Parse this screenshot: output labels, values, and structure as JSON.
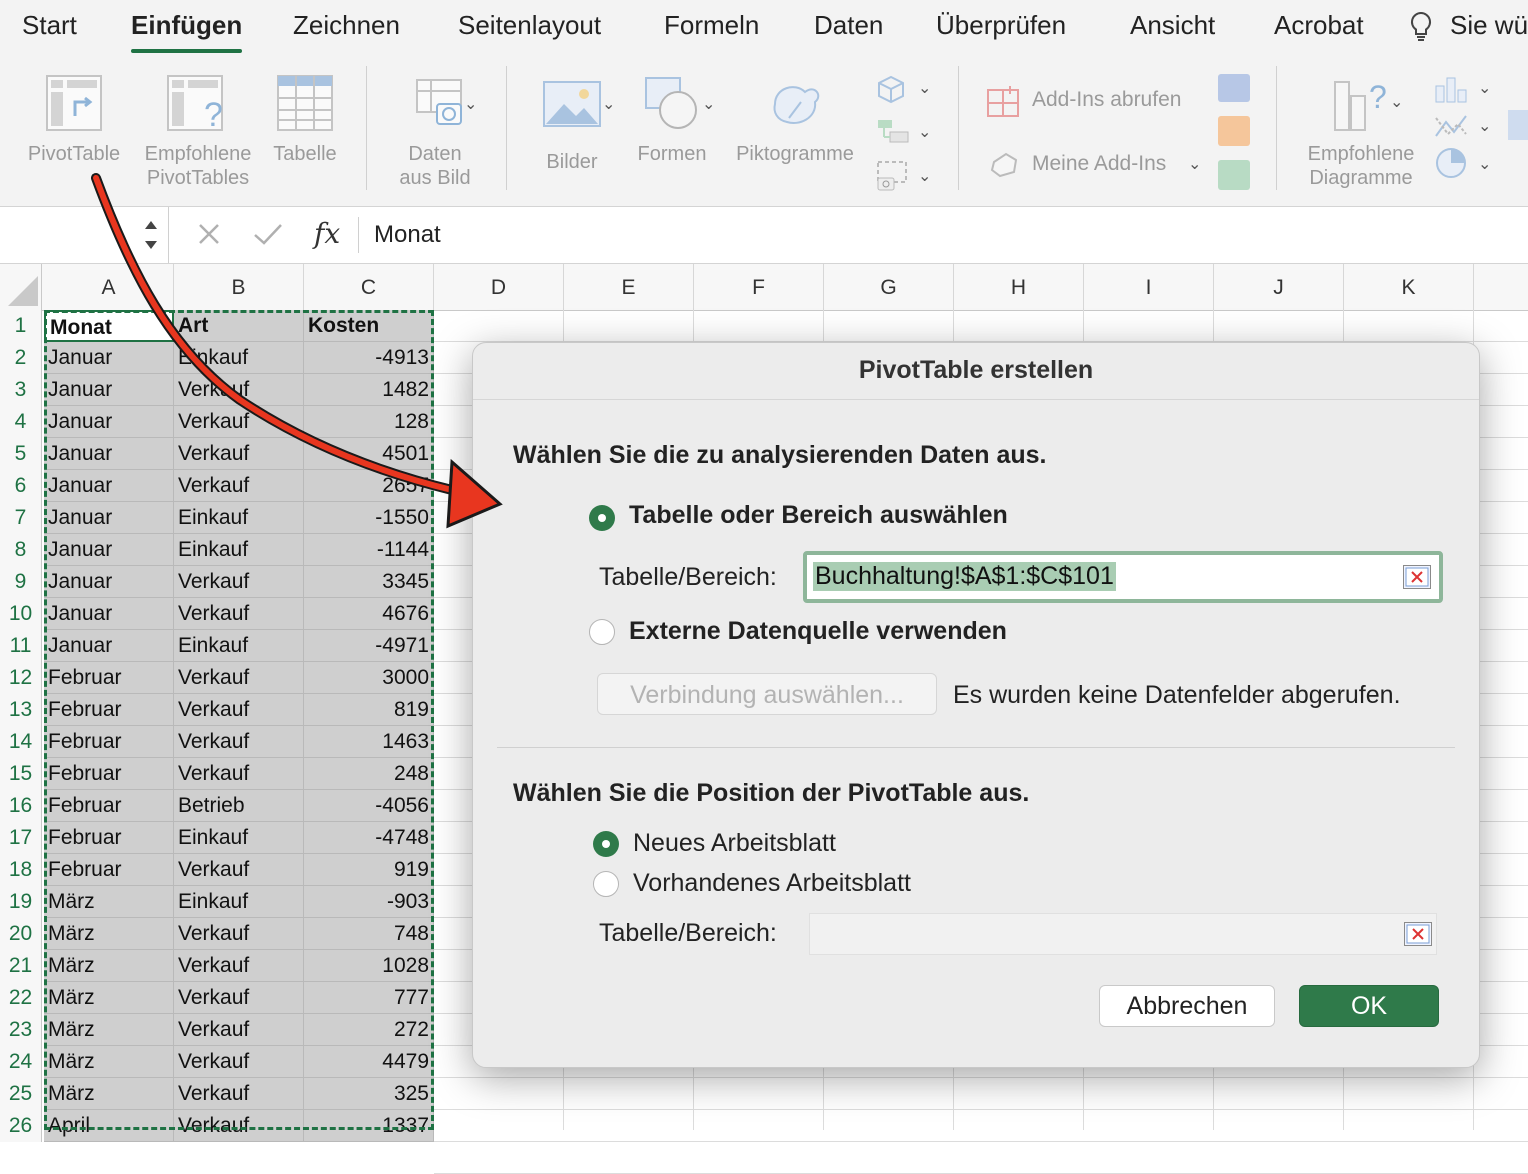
{
  "ribbon": {
    "tabs": [
      "Start",
      "Einfügen",
      "Zeichnen",
      "Seitenlayout",
      "Formeln",
      "Daten",
      "Überprüfen",
      "Ansicht",
      "Acrobat",
      "Sie wü"
    ],
    "active_tab": "Einfügen",
    "tell_me_icon": "lightbulb-icon",
    "buttons": {
      "pivottable": "PivotTable",
      "recommended_line1": "Empfohlene",
      "recommended_line2": "PivotTables",
      "table": "Tabelle",
      "data_from_image_line1": "Daten",
      "data_from_image_line2": "aus Bild",
      "pictures": "Bilder",
      "shapes": "Formen",
      "icons": "Piktogramme",
      "get_addins": "Add-Ins abrufen",
      "my_addins": "Meine Add-Ins",
      "recommended_charts_line1": "Empfohlene",
      "recommended_charts_line2": "Diagramme"
    }
  },
  "formula_bar": {
    "cancel_icon": "close-icon",
    "confirm_icon": "checkmark-icon",
    "fx": "fx",
    "value": "Monat"
  },
  "sheet": {
    "columns": [
      "A",
      "B",
      "C",
      "D",
      "E",
      "F",
      "G",
      "H",
      "I",
      "J",
      "K"
    ],
    "rows": [
      {
        "n": "1",
        "a": "Monat",
        "b": "Art",
        "c": "Kosten"
      },
      {
        "n": "2",
        "a": "Januar",
        "b": "Einkauf",
        "c": "-4913"
      },
      {
        "n": "3",
        "a": "Januar",
        "b": "Verkauf",
        "c": "1482"
      },
      {
        "n": "4",
        "a": "Januar",
        "b": "Verkauf",
        "c": "128"
      },
      {
        "n": "5",
        "a": "Januar",
        "b": "Verkauf",
        "c": "4501"
      },
      {
        "n": "6",
        "a": "Januar",
        "b": "Verkauf",
        "c": "2657"
      },
      {
        "n": "7",
        "a": "Januar",
        "b": "Einkauf",
        "c": "-1550"
      },
      {
        "n": "8",
        "a": "Januar",
        "b": "Einkauf",
        "c": "-1144"
      },
      {
        "n": "9",
        "a": "Januar",
        "b": "Verkauf",
        "c": "3345"
      },
      {
        "n": "10",
        "a": "Januar",
        "b": "Verkauf",
        "c": "4676"
      },
      {
        "n": "11",
        "a": "Januar",
        "b": "Einkauf",
        "c": "-4971"
      },
      {
        "n": "12",
        "a": "Februar",
        "b": "Verkauf",
        "c": "3000"
      },
      {
        "n": "13",
        "a": "Februar",
        "b": "Verkauf",
        "c": "819"
      },
      {
        "n": "14",
        "a": "Februar",
        "b": "Verkauf",
        "c": "1463"
      },
      {
        "n": "15",
        "a": "Februar",
        "b": "Verkauf",
        "c": "248"
      },
      {
        "n": "16",
        "a": "Februar",
        "b": "Betrieb",
        "c": "-4056"
      },
      {
        "n": "17",
        "a": "Februar",
        "b": "Einkauf",
        "c": "-4748"
      },
      {
        "n": "18",
        "a": "Februar",
        "b": "Verkauf",
        "c": "919"
      },
      {
        "n": "19",
        "a": "März",
        "b": "Einkauf",
        "c": "-903"
      },
      {
        "n": "20",
        "a": "März",
        "b": "Verkauf",
        "c": "748"
      },
      {
        "n": "21",
        "a": "März",
        "b": "Verkauf",
        "c": "1028"
      },
      {
        "n": "22",
        "a": "März",
        "b": "Verkauf",
        "c": "777"
      },
      {
        "n": "23",
        "a": "März",
        "b": "Verkauf",
        "c": "272"
      },
      {
        "n": "24",
        "a": "März",
        "b": "Verkauf",
        "c": "4479"
      },
      {
        "n": "25",
        "a": "März",
        "b": "Verkauf",
        "c": "325"
      },
      {
        "n": "26",
        "a": "April",
        "b": "Verkauf",
        "c": "1337"
      }
    ]
  },
  "dialog": {
    "title": "PivotTable erstellen",
    "section1": "Wählen Sie die zu analysierenden Daten aus.",
    "option_table": "Tabelle oder Bereich auswählen",
    "range_label": "Tabelle/Bereich:",
    "range_value": "Buchhaltung!$A$1:$C$101",
    "option_external": "Externe Datenquelle verwenden",
    "connection_button": "Verbindung auswählen...",
    "no_fields_text": "Es wurden keine Datenfelder abgerufen.",
    "section2": "Wählen Sie die Position der PivotTable aus.",
    "option_new_sheet": "Neues Arbeitsblatt",
    "option_existing_sheet": "Vorhandenes Arbeitsblatt",
    "location_label": "Tabelle/Bereich:",
    "location_value": "",
    "cancel": "Abbrechen",
    "ok": "OK",
    "accent": "#2f7a4a"
  },
  "annotation_arrow_color": "#e8361f"
}
